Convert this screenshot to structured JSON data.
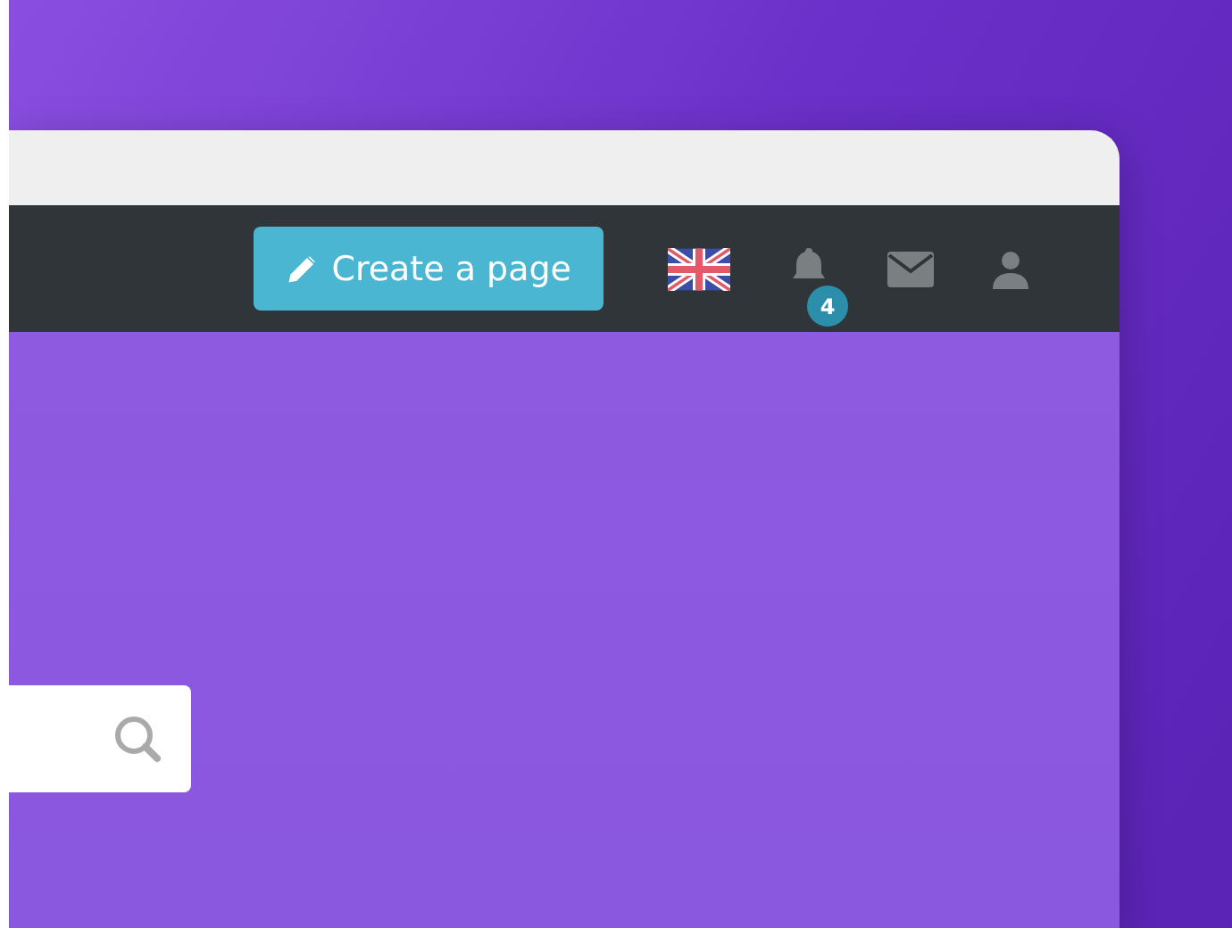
{
  "navbar": {
    "create_button": "Create a page",
    "notification_count": "4"
  }
}
